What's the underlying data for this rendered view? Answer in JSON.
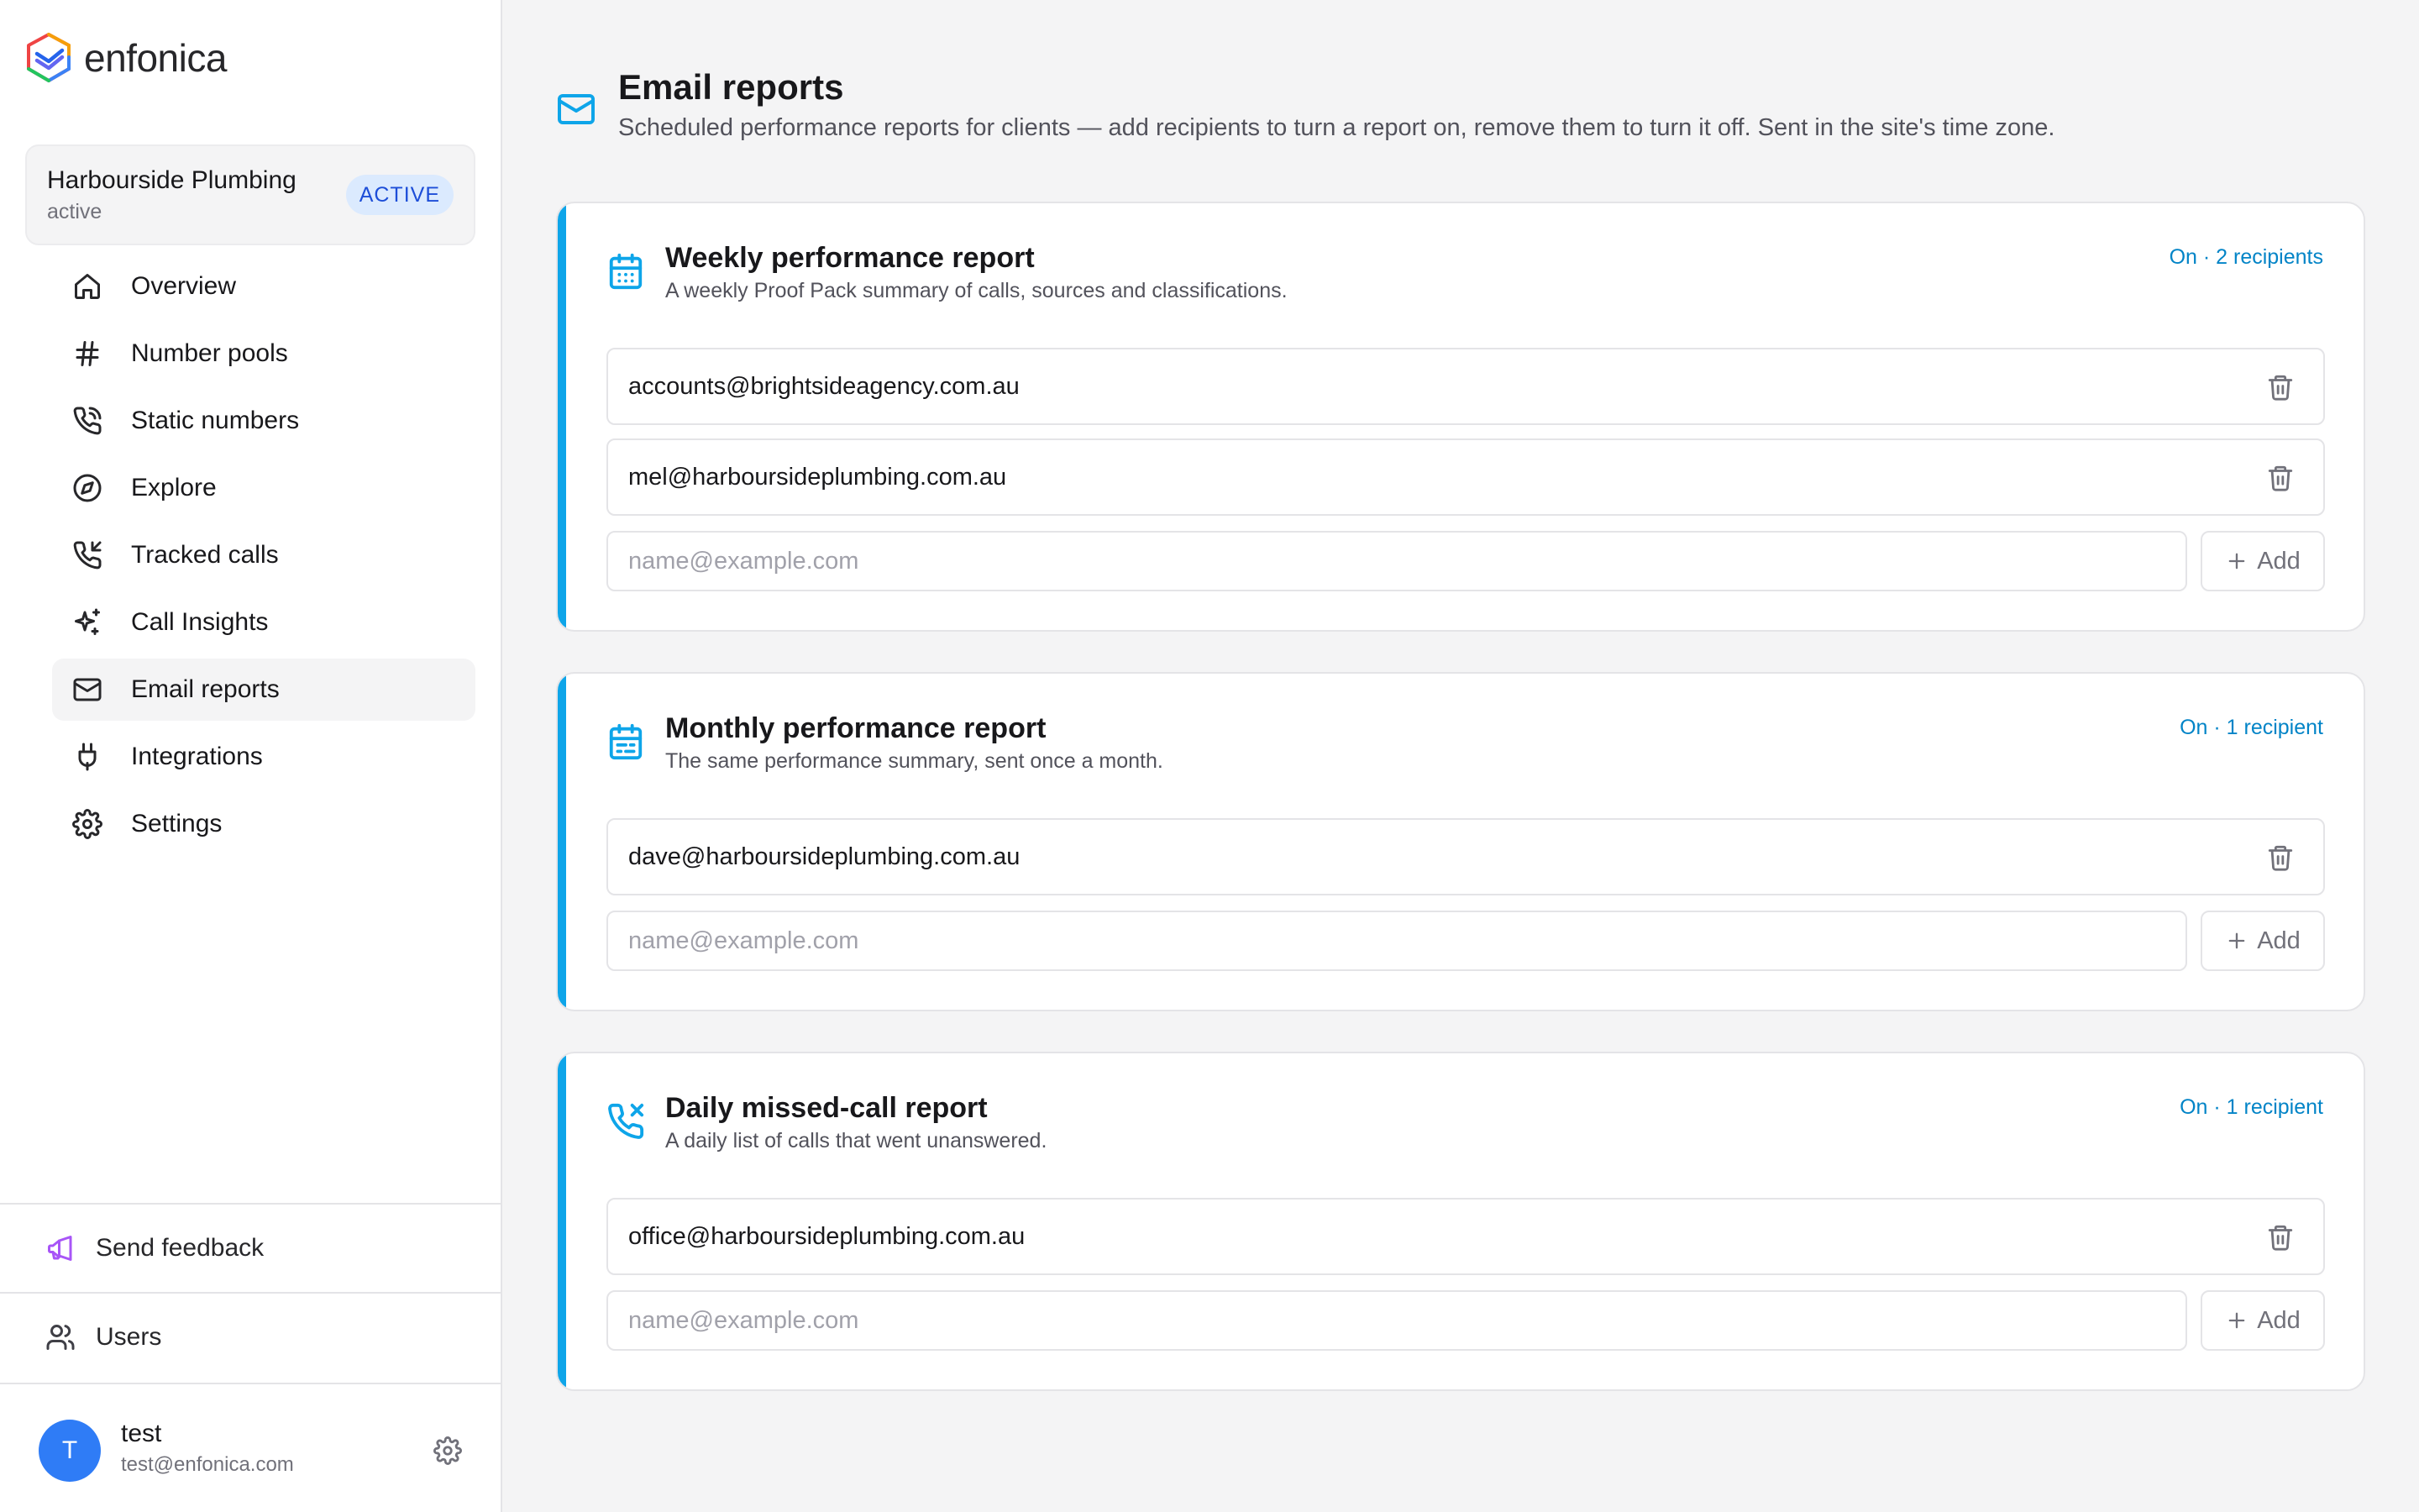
{
  "brand": {
    "name": "enfonica"
  },
  "site": {
    "name": "Harbourside Plumbing",
    "status": "active",
    "badge": "ACTIVE"
  },
  "nav": [
    {
      "label": "Overview",
      "icon": "home-icon"
    },
    {
      "label": "Number pools",
      "icon": "hash-icon"
    },
    {
      "label": "Static numbers",
      "icon": "phone-call-icon"
    },
    {
      "label": "Explore",
      "icon": "compass-icon"
    },
    {
      "label": "Tracked calls",
      "icon": "phone-incoming-icon"
    },
    {
      "label": "Call Insights",
      "icon": "sparkles-icon"
    },
    {
      "label": "Email reports",
      "icon": "mail-icon",
      "active": true
    },
    {
      "label": "Integrations",
      "icon": "plug-icon"
    },
    {
      "label": "Settings",
      "icon": "gear-icon"
    }
  ],
  "footer": {
    "feedback_label": "Send feedback",
    "users_label": "Users",
    "user": {
      "initial": "T",
      "name": "test",
      "email": "test@enfonica.com"
    }
  },
  "page": {
    "title": "Email reports",
    "subtitle": "Scheduled performance reports for clients — add recipients to turn a report on, remove them to turn it off. Sent in the site's time zone."
  },
  "add_placeholder": "name@example.com",
  "add_label": "Add",
  "reports": [
    {
      "title": "Weekly performance report",
      "description": "A weekly Proof Pack summary of calls, sources and classifications.",
      "status": "On · 2 recipients",
      "icon": "calendar-grid-icon",
      "recipients": [
        "accounts@brightsideagency.com.au",
        "mel@harboursideplumbing.com.au"
      ]
    },
    {
      "title": "Monthly performance report",
      "description": "The same performance summary, sent once a month.",
      "status": "On · 1 recipient",
      "icon": "calendar-range-icon",
      "recipients": [
        "dave@harboursideplumbing.com.au"
      ]
    },
    {
      "title": "Daily missed-call report",
      "description": "A daily list of calls that went unanswered.",
      "status": "On · 1 recipient",
      "icon": "phone-missed-icon",
      "recipients": [
        "office@harboursideplumbing.com.au"
      ]
    }
  ],
  "colors": {
    "accent": "#0ea5e9",
    "status": "#0284c7",
    "badge_bg": "#dbeafe",
    "badge_text": "#1d4ed8",
    "avatar": "#2f7cf6"
  }
}
